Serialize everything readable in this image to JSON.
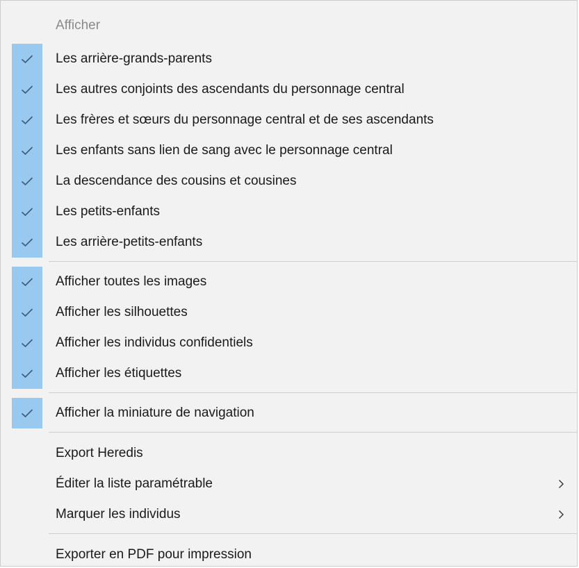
{
  "menu": {
    "header": "Afficher",
    "group1": [
      {
        "label": "Les arrière-grands-parents",
        "checked": true
      },
      {
        "label": "Les autres conjoints des ascendants du personnage central",
        "checked": true
      },
      {
        "label": "Les frères et sœurs du personnage central et de ses ascendants",
        "checked": true
      },
      {
        "label": "Les enfants sans lien de sang avec le personnage central",
        "checked": true
      },
      {
        "label": "La descendance des cousins et cousines",
        "checked": true
      },
      {
        "label": "Les petits-enfants",
        "checked": true
      },
      {
        "label": "Les arrière-petits-enfants",
        "checked": true
      }
    ],
    "group2": [
      {
        "label": "Afficher toutes les images",
        "checked": true
      },
      {
        "label": "Afficher les silhouettes",
        "checked": true
      },
      {
        "label": "Afficher les individus confidentiels",
        "checked": true
      },
      {
        "label": "Afficher les étiquettes",
        "checked": true
      }
    ],
    "group3": [
      {
        "label": "Afficher la miniature de navigation",
        "checked": true
      }
    ],
    "group4": [
      {
        "label": "Export Heredis",
        "has_submenu": false
      },
      {
        "label": "Éditer la liste paramétrable",
        "has_submenu": true
      },
      {
        "label": "Marquer les individus",
        "has_submenu": true
      }
    ],
    "group5": [
      {
        "label": "Exporter en PDF pour impression",
        "has_submenu": false
      }
    ]
  },
  "colors": {
    "menu_background": "#f2f2f2",
    "check_highlight": "#99c9ef",
    "check_mark": "#3a5a7a",
    "header_text": "#8a8a8a",
    "separator": "#cfcfcf"
  },
  "icons": {
    "checkmark": "checkmark-icon",
    "submenu": "chevron-right-icon"
  }
}
